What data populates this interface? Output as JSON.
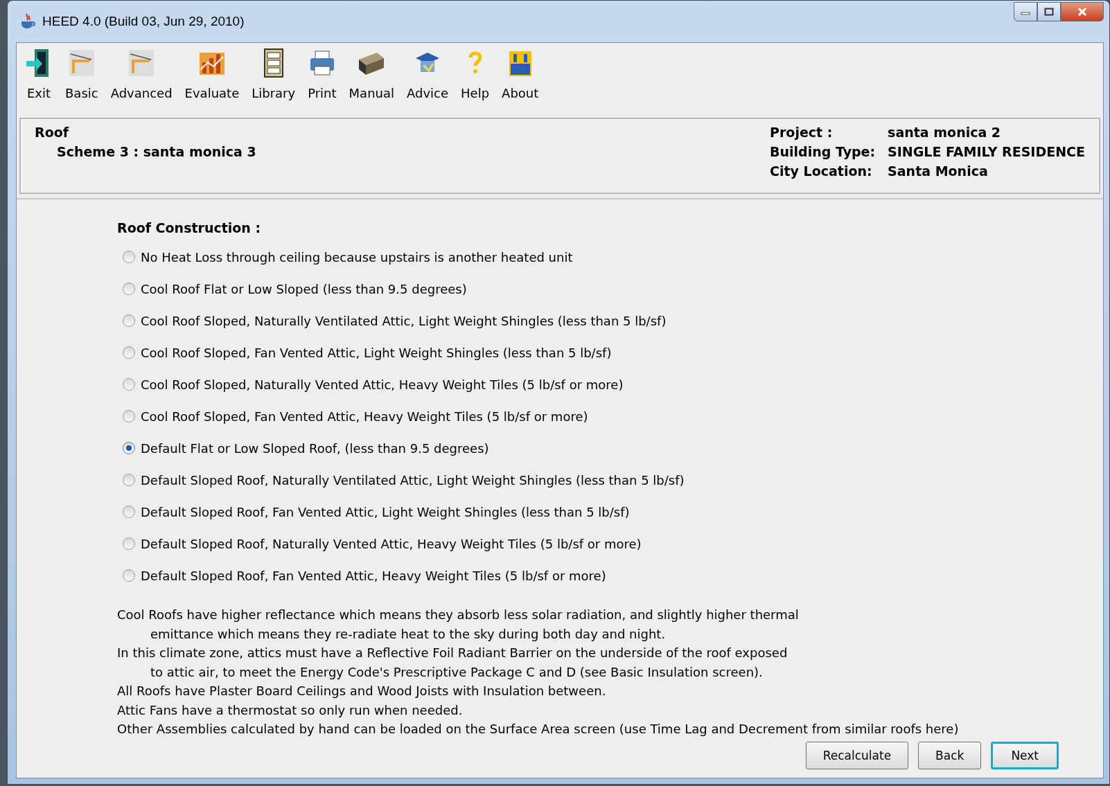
{
  "window": {
    "title": "HEED 4.0 (Build 03, Jun 29, 2010)"
  },
  "toolbar": [
    {
      "label": "Exit",
      "kind": "exit"
    },
    {
      "label": "Basic",
      "kind": "basic"
    },
    {
      "label": "Advanced",
      "kind": "advanced"
    },
    {
      "label": "Evaluate",
      "kind": "evaluate"
    },
    {
      "label": "Library",
      "kind": "library"
    },
    {
      "label": "Print",
      "kind": "print"
    },
    {
      "label": "Manual",
      "kind": "manual"
    },
    {
      "label": "Advice",
      "kind": "advice"
    },
    {
      "label": "Help",
      "kind": "help"
    },
    {
      "label": "About",
      "kind": "about"
    }
  ],
  "header": {
    "section": "Roof",
    "scheme": "Scheme 3 : santa monica 3",
    "info": [
      {
        "label": "Project :",
        "value": "santa monica 2"
      },
      {
        "label": "Building Type:",
        "value": "SINGLE FAMILY RESIDENCE"
      },
      {
        "label": "City Location:",
        "value": "Santa Monica"
      }
    ]
  },
  "roof_construction": {
    "heading": "Roof Construction :",
    "options": [
      {
        "label": "No Heat Loss through ceiling because upstairs is another heated unit",
        "selected": false
      },
      {
        "label": "Cool Roof Flat or Low Sloped (less than 9.5 degrees)",
        "selected": false
      },
      {
        "label": "Cool Roof Sloped, Naturally Ventilated Attic, Light Weight Shingles (less than 5 lb/sf)",
        "selected": false
      },
      {
        "label": "Cool Roof Sloped, Fan Vented Attic, Light Weight Shingles (less than 5 lb/sf)",
        "selected": false
      },
      {
        "label": "Cool Roof Sloped, Naturally Vented Attic, Heavy Weight Tiles (5 lb/sf or more)",
        "selected": false
      },
      {
        "label": "Cool Roof Sloped, Fan Vented Attic, Heavy Weight Tiles (5 lb/sf or more)",
        "selected": false
      },
      {
        "label": "Default Flat or Low Sloped Roof, (less than 9.5 degrees)",
        "selected": true
      },
      {
        "label": "Default Sloped Roof, Naturally Ventilated Attic, Light Weight Shingles (less than 5 lb/sf)",
        "selected": false
      },
      {
        "label": "Default Sloped Roof, Fan Vented Attic, Light Weight Shingles (less than 5 lb/sf)",
        "selected": false
      },
      {
        "label": "Default Sloped Roof, Naturally Vented Attic, Heavy Weight Tiles (5 lb/sf or more)",
        "selected": false
      },
      {
        "label": "Default Sloped Roof, Fan Vented Attic, Heavy Weight Tiles (5 lb/sf or more)",
        "selected": false
      }
    ]
  },
  "notes": [
    {
      "lines": [
        "Cool Roofs have higher reflectance which means they absorb less solar radiation, and slightly higher thermal",
        "emittance which means they re-radiate heat to the sky during both day and night."
      ]
    },
    {
      "lines": [
        "In this climate zone, attics must have a Reflective Foil Radiant Barrier on the underside of the roof exposed",
        "to attic air, to meet the Energy Code's Prescriptive Package C and D (see Basic Insulation screen)."
      ]
    },
    {
      "lines": [
        "All Roofs have Plaster Board Ceilings and Wood Joists with Insulation between."
      ]
    },
    {
      "lines": [
        "Attic Fans have a thermostat so only run when needed."
      ]
    },
    {
      "lines": [
        "Other Assemblies calculated by hand can be loaded on the Surface Area screen (use Time Lag and Decrement from similar roofs here)"
      ]
    }
  ],
  "buttons": [
    {
      "label": "Recalculate",
      "focused": false
    },
    {
      "label": "Back",
      "focused": false
    },
    {
      "label": "Next",
      "focused": true
    }
  ]
}
